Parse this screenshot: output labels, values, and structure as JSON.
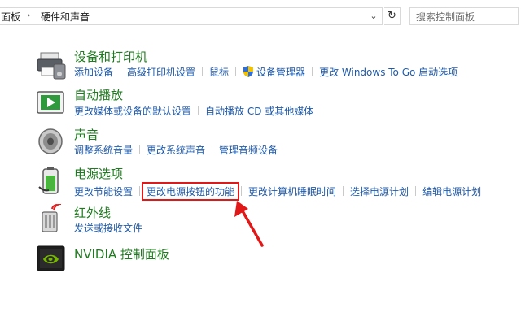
{
  "address_bar": {
    "crumbs": [
      "面板",
      "硬件和声音"
    ],
    "dropdown_glyph": "⌄",
    "refresh_glyph": "↻"
  },
  "search": {
    "placeholder": "搜索控制面板"
  },
  "categories": [
    {
      "title": "设备和打印机",
      "icon": "printer-icon",
      "links": [
        "添加设备",
        "高级打印机设置",
        "鼠标",
        "设备管理器",
        "更改 Windows To Go 启动选项"
      ]
    },
    {
      "title": "自动播放",
      "icon": "autoplay-icon",
      "links": [
        "更改媒体或设备的默认设置",
        "自动播放 CD 或其他媒体"
      ]
    },
    {
      "title": "声音",
      "icon": "speaker-icon",
      "links": [
        "调整系统音量",
        "更改系统声音",
        "管理音频设备"
      ]
    },
    {
      "title": "电源选项",
      "icon": "battery-icon",
      "links": [
        "更改节能设置",
        "更改电源按钮的功能",
        "更改计算机睡眠时间",
        "选择电源计划",
        "编辑电源计划"
      ]
    },
    {
      "title": "红外线",
      "icon": "infrared-icon",
      "links": [
        "发送或接收文件"
      ]
    },
    {
      "title": "NVIDIA 控制面板",
      "icon": "nvidia-icon",
      "links": []
    }
  ],
  "annotation": {
    "highlight_color": "#e01818",
    "highlighted_link": "更改电源按钮的功能"
  },
  "colors": {
    "title_green": "#1e7a1e",
    "link_blue": "#1f5aa8"
  }
}
